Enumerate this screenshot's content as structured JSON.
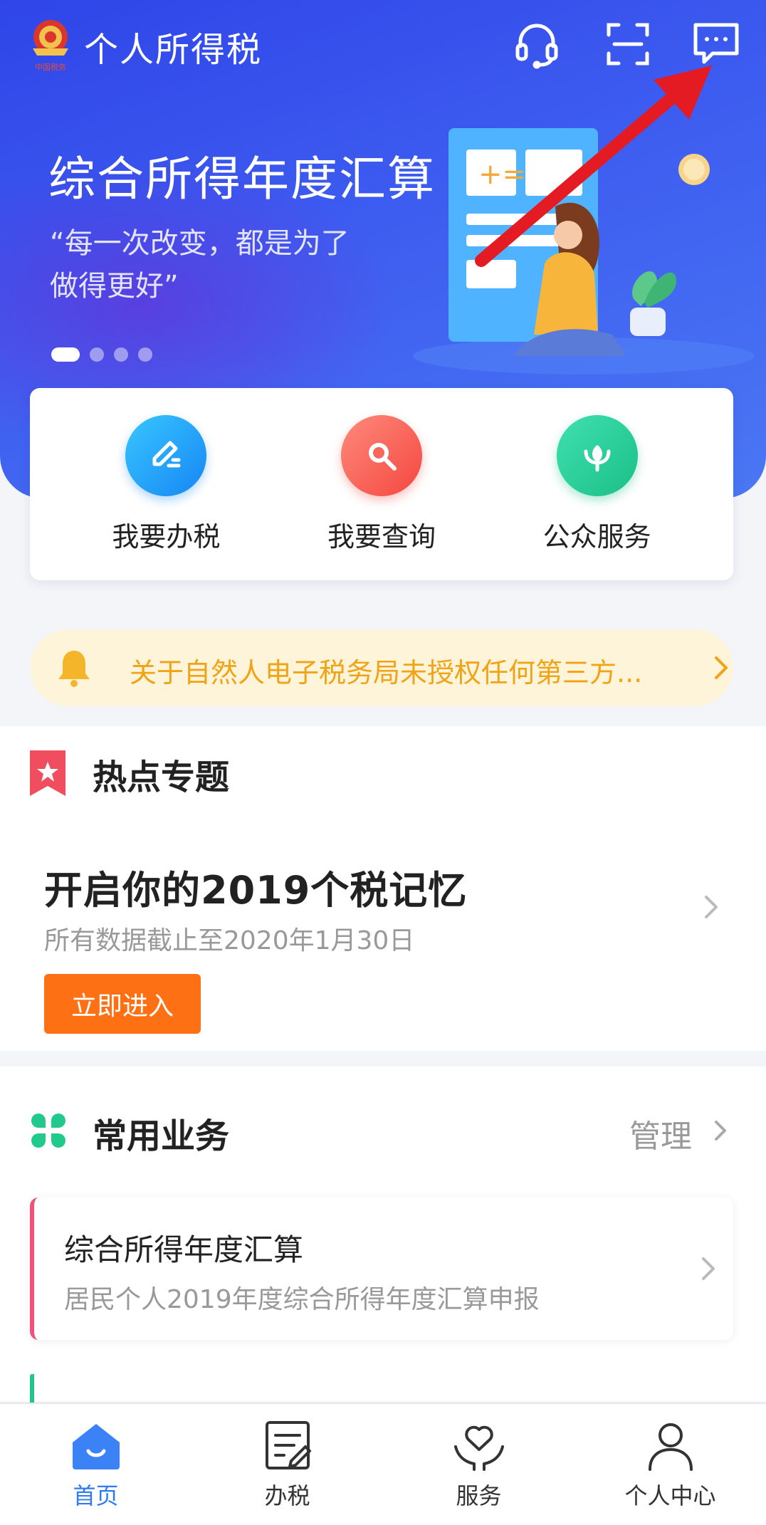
{
  "header": {
    "logo_text": "中国税务",
    "app_title": "个人所得税",
    "icons": [
      "headset-icon",
      "scan-icon",
      "message-icon"
    ]
  },
  "banner": {
    "title": "综合所得年度汇算",
    "quote": "“每一次改变，都是为了做得更好”",
    "slide_count": 4,
    "active_slide": 1
  },
  "quick_actions": [
    {
      "label": "我要办税",
      "icon": "pencil-icon",
      "color": "#1e90f5"
    },
    {
      "label": "我要查询",
      "icon": "search-icon",
      "color": "#f4574c"
    },
    {
      "label": "公众服务",
      "icon": "flower-icon",
      "color": "#21c88c"
    }
  ],
  "notice": {
    "text": "关于自然人电子税务局未授权任何第三方...",
    "color": "#f1a316"
  },
  "hot_topics": {
    "section_title": "热点专题",
    "topic_title": "开启你的2019个税记忆",
    "topic_sub": "所有数据截止至2020年1月30日",
    "button_label": "立即进入",
    "button_color": "#fd7013"
  },
  "common_business": {
    "section_title": "常用业务",
    "manage_label": "管理",
    "items": [
      {
        "title": "综合所得年度汇算",
        "subtitle": "居民个人2019年度综合所得年度汇算申报",
        "accent": "#f0527a"
      }
    ]
  },
  "tabbar": {
    "active_color": "#2f7bf2",
    "tabs": [
      {
        "label": "首页",
        "icon": "home-icon",
        "active": true
      },
      {
        "label": "办税",
        "icon": "tax-form-icon",
        "active": false
      },
      {
        "label": "服务",
        "icon": "heart-hands-icon",
        "active": false
      },
      {
        "label": "个人中心",
        "icon": "person-icon",
        "active": false
      }
    ]
  }
}
